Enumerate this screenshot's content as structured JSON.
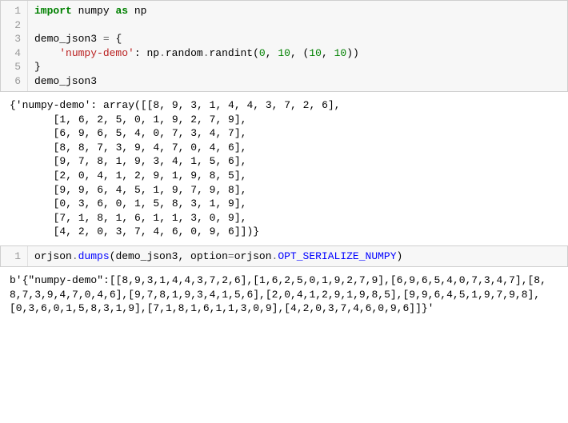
{
  "cells": [
    {
      "type": "code",
      "lines": [
        [
          {
            "t": "import",
            "c": "kw"
          },
          {
            "t": " "
          },
          {
            "t": "numpy",
            "c": "name"
          },
          {
            "t": " "
          },
          {
            "t": "as",
            "c": "kw"
          },
          {
            "t": " "
          },
          {
            "t": "np",
            "c": "name"
          }
        ],
        [],
        [
          {
            "t": "demo_json3 ",
            "c": "name"
          },
          {
            "t": "=",
            "c": "op"
          },
          {
            "t": " {"
          }
        ],
        [
          {
            "t": "    "
          },
          {
            "t": "'numpy-demo'",
            "c": "str"
          },
          {
            "t": ": np"
          },
          {
            "t": ".",
            "c": "op"
          },
          {
            "t": "random"
          },
          {
            "t": ".",
            "c": "op"
          },
          {
            "t": "randint("
          },
          {
            "t": "0",
            "c": "num"
          },
          {
            "t": ", "
          },
          {
            "t": "10",
            "c": "num"
          },
          {
            "t": ", ("
          },
          {
            "t": "10",
            "c": "num"
          },
          {
            "t": ", "
          },
          {
            "t": "10",
            "c": "num"
          },
          {
            "t": "))"
          }
        ],
        [
          {
            "t": "}"
          }
        ],
        [
          {
            "t": "demo_json3",
            "c": "name"
          }
        ]
      ],
      "output": "{'numpy-demo': array([[8, 9, 3, 1, 4, 4, 3, 7, 2, 6],\n       [1, 6, 2, 5, 0, 1, 9, 2, 7, 9],\n       [6, 9, 6, 5, 4, 0, 7, 3, 4, 7],\n       [8, 8, 7, 3, 9, 4, 7, 0, 4, 6],\n       [9, 7, 8, 1, 9, 3, 4, 1, 5, 6],\n       [2, 0, 4, 1, 2, 9, 1, 9, 8, 5],\n       [9, 9, 6, 4, 5, 1, 9, 7, 9, 8],\n       [0, 3, 6, 0, 1, 5, 8, 3, 1, 9],\n       [7, 1, 8, 1, 6, 1, 1, 3, 0, 9],\n       [4, 2, 0, 3, 7, 4, 6, 0, 9, 6]])}"
    },
    {
      "type": "code",
      "lines": [
        [
          {
            "t": "orjson"
          },
          {
            "t": ".",
            "c": "op"
          },
          {
            "t": "dumps",
            "c": "func"
          },
          {
            "t": "(demo_json3, option"
          },
          {
            "t": "=",
            "c": "op"
          },
          {
            "t": "orjson"
          },
          {
            "t": ".",
            "c": "op"
          },
          {
            "t": "OPT_SERIALIZE_NUMPY",
            "c": "const"
          },
          {
            "t": ")"
          }
        ]
      ],
      "output": "b'{\"numpy-demo\":[[8,9,3,1,4,4,3,7,2,6],[1,6,2,5,0,1,9,2,7,9],[6,9,6,5,4,0,7,3,4,7],[8,8,7,3,9,4,7,0,4,6],[9,7,8,1,9,3,4,1,5,6],[2,0,4,1,2,9,1,9,8,5],[9,9,6,4,5,1,9,7,9,8],[0,3,6,0,1,5,8,3,1,9],[7,1,8,1,6,1,1,3,0,9],[4,2,0,3,7,4,6,0,9,6]]}'",
      "output_wrap": true
    }
  ],
  "chart_data": {
    "type": "table",
    "title": "numpy-demo 10x10 randint array",
    "rows": [
      [
        8,
        9,
        3,
        1,
        4,
        4,
        3,
        7,
        2,
        6
      ],
      [
        1,
        6,
        2,
        5,
        0,
        1,
        9,
        2,
        7,
        9
      ],
      [
        6,
        9,
        6,
        5,
        4,
        0,
        7,
        3,
        4,
        7
      ],
      [
        8,
        8,
        7,
        3,
        9,
        4,
        7,
        0,
        4,
        6
      ],
      [
        9,
        7,
        8,
        1,
        9,
        3,
        4,
        1,
        5,
        6
      ],
      [
        2,
        0,
        4,
        1,
        2,
        9,
        1,
        9,
        8,
        5
      ],
      [
        9,
        9,
        6,
        4,
        5,
        1,
        9,
        7,
        9,
        8
      ],
      [
        0,
        3,
        6,
        0,
        1,
        5,
        8,
        3,
        1,
        9
      ],
      [
        7,
        1,
        8,
        1,
        6,
        1,
        1,
        3,
        0,
        9
      ],
      [
        4,
        2,
        0,
        3,
        7,
        4,
        6,
        0,
        9,
        6
      ]
    ]
  }
}
